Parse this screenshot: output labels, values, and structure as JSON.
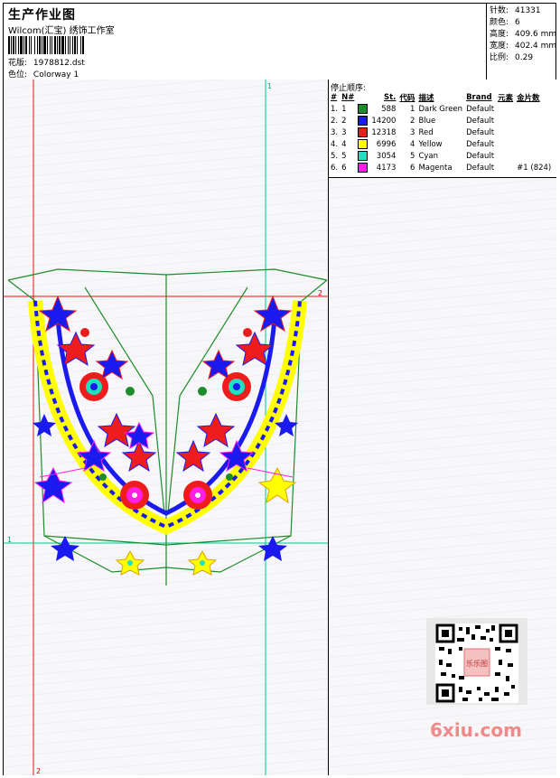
{
  "header": {
    "title": "生产作业图",
    "studio": "Wilcom(汇宝) 绣饰工作室",
    "design_label": "花版:",
    "design_value": "1978812.dst",
    "colorway_label": "色位:",
    "colorway_value": "Colorway 1"
  },
  "stats": {
    "stitches_label": "针数:",
    "stitches_value": "41331",
    "colors_label": "颜色:",
    "colors_value": "6",
    "height_label": "高度:",
    "height_value": "409.6 mm",
    "width_label": "宽度:",
    "width_value": "402.4 mm",
    "scale_label": "比例:",
    "scale_value": "0.29"
  },
  "stop_sequence": {
    "label": "停止顺序:",
    "headers": [
      "#",
      "N#",
      "St.",
      "代码",
      "描述",
      "Brand",
      "元素",
      "金片数"
    ],
    "rows": [
      {
        "idx": "1.",
        "n": "1",
        "color": "#1e8c2a",
        "st": "588",
        "code": "1",
        "desc": "Dark Green",
        "brand": "Default",
        "element": "",
        "sequins": ""
      },
      {
        "idx": "2.",
        "n": "2",
        "color": "#1a1aee",
        "st": "14200",
        "code": "2",
        "desc": "Blue",
        "brand": "Default",
        "element": "",
        "sequins": ""
      },
      {
        "idx": "3.",
        "n": "3",
        "color": "#ee1c1c",
        "st": "12318",
        "code": "3",
        "desc": "Red",
        "brand": "Default",
        "element": "",
        "sequins": ""
      },
      {
        "idx": "4.",
        "n": "4",
        "color": "#ffff00",
        "st": "6996",
        "code": "4",
        "desc": "Yellow",
        "brand": "Default",
        "element": "",
        "sequins": ""
      },
      {
        "idx": "5.",
        "n": "5",
        "color": "#20e0c0",
        "st": "3054",
        "code": "5",
        "desc": "Cyan",
        "brand": "Default",
        "element": "",
        "sequins": ""
      },
      {
        "idx": "6.",
        "n": "6",
        "color": "#ff1ee6",
        "st": "4173",
        "code": "6",
        "desc": "Magenta",
        "brand": "Default",
        "element": "",
        "sequins": "#1 (824)"
      }
    ]
  },
  "canvas": {
    "guide_labels": [
      "1",
      "2",
      "1",
      "2"
    ]
  },
  "watermark": {
    "text": "6xiu.com",
    "qr_caption": "乐乐图"
  }
}
